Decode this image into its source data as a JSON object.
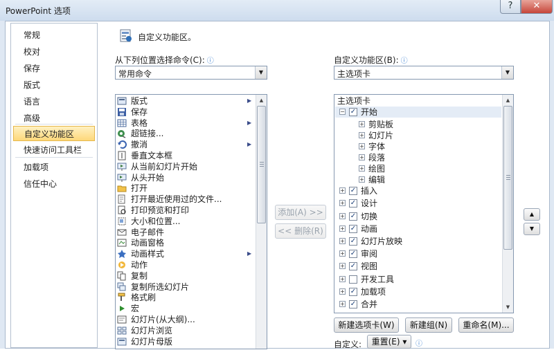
{
  "window": {
    "title": "PowerPoint 选项",
    "help_label": "?",
    "close_label": "✕"
  },
  "nav": {
    "items": [
      {
        "label": "常规"
      },
      {
        "label": "校对"
      },
      {
        "label": "保存"
      },
      {
        "label": "版式"
      },
      {
        "label": "语言"
      },
      {
        "label": "高级"
      },
      {
        "label": "自定义功能区",
        "selected": true
      },
      {
        "label": "快速访问工具栏"
      },
      {
        "label": "加载项"
      },
      {
        "label": "信任中心"
      }
    ]
  },
  "header": {
    "title": "自定义功能区。"
  },
  "left_panel": {
    "label": "从下列位置选择命令(C):",
    "info": "ⓘ",
    "dropdown_value": "常用命令",
    "commands": [
      {
        "label": "版式",
        "icon": "layout-icon",
        "has_submenu": true
      },
      {
        "label": "保存",
        "icon": "save-icon"
      },
      {
        "label": "表格",
        "icon": "table-icon",
        "has_submenu": true
      },
      {
        "label": "超链接...",
        "icon": "hyperlink-icon"
      },
      {
        "label": "撤消",
        "icon": "undo-icon",
        "has_submenu": true
      },
      {
        "label": "垂直文本框",
        "icon": "vertical-textbox-icon"
      },
      {
        "label": "从当前幻灯片开始",
        "icon": "slideshow-current-icon"
      },
      {
        "label": "从头开始",
        "icon": "slideshow-start-icon"
      },
      {
        "label": "打开",
        "icon": "open-folder-icon"
      },
      {
        "label": "打开最近使用过的文件...",
        "icon": "recent-file-icon"
      },
      {
        "label": "打印预览和打印",
        "icon": "print-preview-icon"
      },
      {
        "label": "大小和位置...",
        "icon": "size-position-icon"
      },
      {
        "label": "电子邮件",
        "icon": "email-icon"
      },
      {
        "label": "动画窗格",
        "icon": "animation-pane-icon"
      },
      {
        "label": "动画样式",
        "icon": "animation-style-icon",
        "has_submenu": true
      },
      {
        "label": "动作",
        "icon": "action-icon"
      },
      {
        "label": "复制",
        "icon": "copy-icon"
      },
      {
        "label": "复制所选幻灯片",
        "icon": "duplicate-slide-icon"
      },
      {
        "label": "格式刷",
        "icon": "format-painter-icon"
      },
      {
        "label": "宏",
        "icon": "macro-icon"
      },
      {
        "label": "幻灯片(从大纲)...",
        "icon": "slides-from-outline-icon"
      },
      {
        "label": "幻灯片浏览",
        "icon": "slide-sorter-icon"
      },
      {
        "label": "幻灯片母版",
        "icon": "slide-master-icon"
      }
    ]
  },
  "middle": {
    "add_label": "添加(A) >>",
    "remove_label": "<< 删除(R)"
  },
  "right_panel": {
    "label": "自定义功能区(B):",
    "info": "ⓘ",
    "dropdown_value": "主选项卡",
    "tree_header": "主选项卡",
    "tabs": [
      {
        "label": "开始",
        "expanded": true,
        "checked": true,
        "groups": [
          "剪贴板",
          "幻灯片",
          "字体",
          "段落",
          "绘图",
          "编辑"
        ]
      },
      {
        "label": "插入",
        "checked": true
      },
      {
        "label": "设计",
        "checked": true
      },
      {
        "label": "切换",
        "checked": true
      },
      {
        "label": "动画",
        "checked": true
      },
      {
        "label": "幻灯片放映",
        "checked": true
      },
      {
        "label": "审阅",
        "checked": true
      },
      {
        "label": "视图",
        "checked": true
      },
      {
        "label": "开发工具",
        "checked": false
      },
      {
        "label": "加载项",
        "checked": true
      },
      {
        "label": "合并",
        "checked": true
      }
    ],
    "new_tab_label": "新建选项卡(W)",
    "new_group_label": "新建组(N)",
    "rename_label": "重命名(M)...",
    "customize_label": "自定义:",
    "reset_label": "重置(E) ▾",
    "reset_info": "ⓘ"
  },
  "icons": {
    "move_up": "▲",
    "move_down": "▼",
    "expand": "⊞",
    "collapse": "⊟",
    "check": "✓",
    "submenu": "▶"
  },
  "colors": {
    "selected_nav_bg": "#fdd87a",
    "selected_nav_border": "#e5b74a",
    "title_bar": "#cddcee",
    "close_button": "#c6463a"
  }
}
